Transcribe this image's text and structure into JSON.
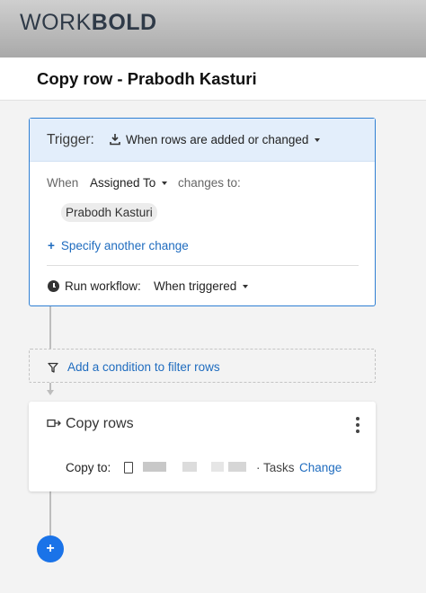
{
  "brand": {
    "logo_light": "WORK",
    "logo_bold": "BOLD"
  },
  "page": {
    "title": "Copy row - Prabodh Kasturi"
  },
  "trigger": {
    "label": "Trigger:",
    "icon": "upload-icon",
    "event": "When rows are added or changed",
    "when_label": "When",
    "column": "Assigned To",
    "changes_to": "changes to:",
    "value_chip": "Prabodh Kasturi",
    "specify_plus": "+",
    "specify_label": "Specify another change",
    "run_label": "Run workflow:",
    "run_value": "When triggered"
  },
  "condition": {
    "label": "Add a condition to filter rows",
    "icon": "filter-icon"
  },
  "action": {
    "title": "Copy rows",
    "icon": "copy-rows-icon",
    "copy_to_label": "Copy to:",
    "sheet_suffix": "· Tasks",
    "change_label": "Change"
  },
  "add_button": {
    "label": "+"
  },
  "colors": {
    "accent": "#1a73e8",
    "link": "#1f6cbf",
    "trigger_header": "#e3eefb",
    "border_active": "#2f7fd3"
  }
}
